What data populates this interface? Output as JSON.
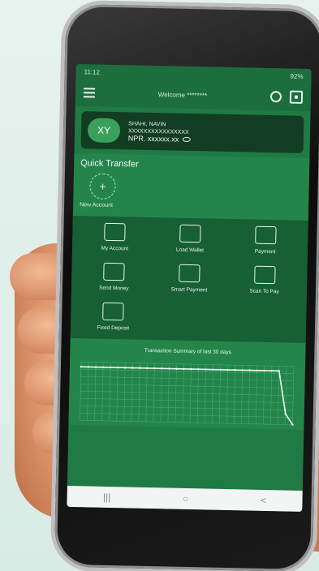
{
  "status": {
    "time": "11:12",
    "battery": "92%"
  },
  "app": {
    "welcome": "Welcome ********"
  },
  "account": {
    "initials": "XY",
    "name": "SHAHI, NAVIN",
    "number": "XXXXXXXXXXXXXXXX",
    "balance": "NPR. xxxxxx.xx"
  },
  "quick_transfer": {
    "title": "Quick Transfer",
    "add_label": "New Account"
  },
  "tiles": [
    {
      "label": "My Account",
      "icon": "account-icon"
    },
    {
      "label": "Load Wallet",
      "icon": "wallet-icon"
    },
    {
      "label": "Payment",
      "icon": "payment-icon"
    },
    {
      "label": "Send Money",
      "icon": "send-money-icon"
    },
    {
      "label": "Smart Payment",
      "icon": "smart-payment-icon"
    },
    {
      "label": "Scan To Pay",
      "icon": "scan-to-pay-icon"
    },
    {
      "label": "Fixed Deposit",
      "icon": "fixed-deposit-icon"
    }
  ],
  "summary": {
    "title": "Transaction Summary of last 30 days"
  },
  "chart_data": {
    "type": "line",
    "title": "Transaction Summary of last 30 days",
    "x": [
      1,
      2,
      3,
      4,
      5,
      6,
      7,
      8,
      9,
      10,
      11,
      12,
      13,
      14,
      15,
      16,
      17,
      18,
      19,
      20,
      21,
      22,
      23,
      24,
      25,
      26,
      27,
      28,
      29,
      30
    ],
    "values": [
      10,
      10,
      10,
      10,
      10,
      10,
      10,
      10,
      10,
      10,
      10,
      10,
      10,
      10,
      10,
      10,
      10,
      10,
      10,
      10,
      10,
      10,
      10,
      10,
      10,
      10,
      10,
      10,
      2,
      0
    ],
    "grid": true
  },
  "navbar": {
    "recent": "|||",
    "home": "○",
    "back": "<"
  }
}
